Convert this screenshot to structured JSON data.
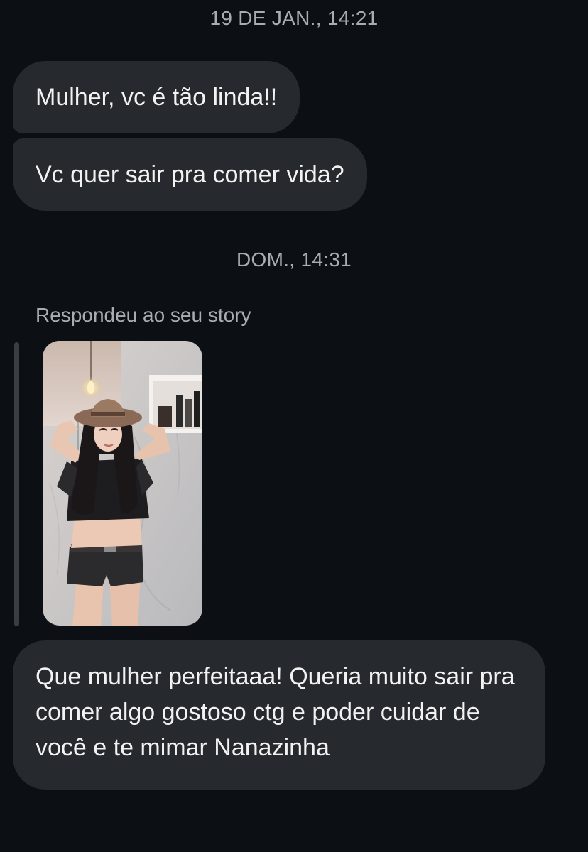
{
  "thread": {
    "timestamp_1": "19 DE JAN., 14:21",
    "message_1": "Mulher, vc é tão linda!!",
    "message_2": "Vc quer sair pra comer vida?",
    "timestamp_2": "DOM., 14:31",
    "reply_label": "Respondeu ao seu story",
    "story_image": "story-photo-woman-cowboy-hat",
    "message_3": "Que mulher perfeitaaa! Queria muito sair pra comer algo gostoso ctg e poder cuidar de você e te mimar Nanazinha"
  },
  "colors": {
    "background": "#0c1014",
    "bubble": "#26292e",
    "muted_text": "#a8adb3",
    "text": "#f2f2f2"
  }
}
